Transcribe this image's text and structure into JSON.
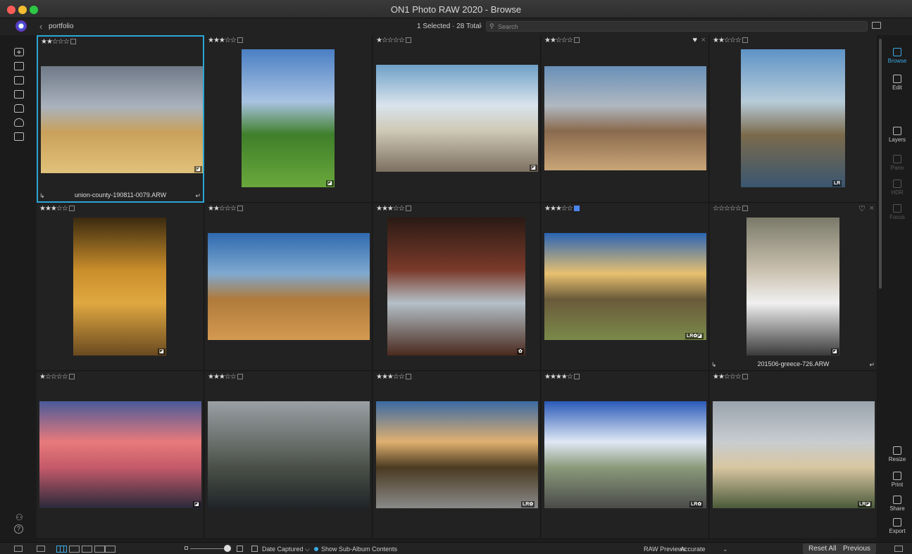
{
  "window": {
    "title": "ON1 Photo RAW 2020 - Browse"
  },
  "topbar": {
    "folder": "portfolio",
    "selection": "1 Selected · 28 Total",
    "search_placeholder": "Search"
  },
  "rightbar": {
    "items": [
      {
        "label": "Browse",
        "state": "active"
      },
      {
        "label": "Edit",
        "state": "normal"
      },
      {
        "label": "Layers",
        "state": "normal"
      },
      {
        "label": "Pano",
        "state": "disabled"
      },
      {
        "label": "HDR",
        "state": "disabled"
      },
      {
        "label": "Focus",
        "state": "disabled"
      },
      {
        "label": "Resize",
        "state": "normal"
      },
      {
        "label": "Print",
        "state": "normal"
      },
      {
        "label": "Share",
        "state": "normal"
      },
      {
        "label": "Export",
        "state": "normal"
      }
    ]
  },
  "photos": [
    {
      "stars": "★★☆☆☆",
      "flag": "none",
      "filename": "union-county-190811-0079.ARW",
      "selected": true,
      "badge": "◪",
      "colors": [
        "#6f7a88",
        "#a9b2bd",
        "#c9a15a",
        "#e1c27a"
      ]
    },
    {
      "stars": "★★★☆☆",
      "flag": "none",
      "badge": "◪",
      "colors": [
        "#4a7fc4",
        "#a9c3e2",
        "#3f7f2a",
        "#6aa83c"
      ]
    },
    {
      "stars": "★☆☆☆☆",
      "flag": "none",
      "badge": "◪",
      "colors": [
        "#6fa0c8",
        "#d9e4ec",
        "#cfc8b6",
        "#7c7060"
      ]
    },
    {
      "stars": "★★☆☆☆",
      "flag": "none",
      "heart": "♥",
      "reject": "×",
      "colors": [
        "#6890b8",
        "#b0b8c0",
        "#8a6a4e",
        "#c9a578"
      ]
    },
    {
      "stars": "★★☆☆☆",
      "flag": "none",
      "badge": "LR",
      "colors": [
        "#5e93c6",
        "#b7ccd9",
        "#7b6b4c",
        "#3a5670"
      ]
    },
    {
      "stars": "★★★☆☆",
      "flag": "none",
      "badge": "◪",
      "colors": [
        "#3a2a10",
        "#c98d2a",
        "#e0a840",
        "#6a4a20"
      ]
    },
    {
      "stars": "★★☆☆☆",
      "flag": "none",
      "colors": [
        "#2f6ab0",
        "#7fa9cf",
        "#b07a3a",
        "#d49a52"
      ]
    },
    {
      "stars": "★★★☆☆",
      "flag": "none",
      "badge": "✿",
      "colors": [
        "#2a1a14",
        "#7a3a2a",
        "#b4c0c8",
        "#4a2a1e"
      ]
    },
    {
      "stars": "★★★☆☆",
      "flag": "blue",
      "badge": "LR✿◪",
      "colors": [
        "#2a64b4",
        "#e8c070",
        "#6a5a3a",
        "#7a8a4a"
      ]
    },
    {
      "stars": "☆☆☆☆☆",
      "flag": "none",
      "heart": "♡",
      "reject": "×",
      "filename": "201506-greece-726.ARW",
      "badge": "◪",
      "colors": [
        "#7a7a6a",
        "#c9c0ae",
        "#f0f0f0",
        "#3a3a3a"
      ]
    },
    {
      "stars": "★☆☆☆☆",
      "flag": "none",
      "badge": "◪",
      "colors": [
        "#4a5a9a",
        "#e87a7a",
        "#c45a6a",
        "#2a2a3a"
      ]
    },
    {
      "stars": "★★★☆☆",
      "flag": "none",
      "colors": [
        "#9aa0a4",
        "#6a706c",
        "#4a5048",
        "#202428"
      ]
    },
    {
      "stars": "★★★☆☆",
      "flag": "none",
      "badge": "LR✿",
      "colors": [
        "#3a6aa4",
        "#e0b070",
        "#4a3a20",
        "#8a8a8a"
      ]
    },
    {
      "stars": "★★★★☆",
      "flag": "none",
      "badge": "LR✿",
      "colors": [
        "#2a5ab8",
        "#dfe8f4",
        "#8a9a7a",
        "#4a4a4a"
      ]
    },
    {
      "stars": "★★☆☆☆",
      "flag": "none",
      "badge": "LR◪",
      "colors": [
        "#9aa4ae",
        "#c8ccd0",
        "#d8c6a0",
        "#4a5a3a"
      ]
    }
  ],
  "bottombar": {
    "sort_label": "Date Captured ⌵",
    "subalbum_label": "Show Sub-Album Contents",
    "raw_label": "RAW Previews",
    "raw_value": "Accurate",
    "reset_label": "Reset All",
    "previous_label": "Previous"
  },
  "colors": {
    "accent": "#2aa6d4",
    "flag_blue": "#4a86ec"
  }
}
